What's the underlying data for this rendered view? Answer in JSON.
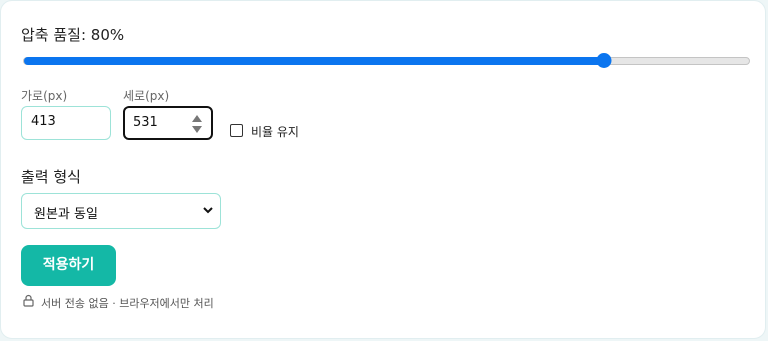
{
  "quality": {
    "label": "압축 품질: 80%",
    "value": 80,
    "min": 0,
    "max": 100,
    "accent_color": "#0b75ef"
  },
  "dimensions": {
    "width_label": "가로(px)",
    "width_value": "413",
    "height_label": "세로(px)",
    "height_value": "531",
    "keep_ratio_label": "비율 유지",
    "keep_ratio_checked": false
  },
  "format": {
    "label": "출력 형식",
    "selected": "원본과 동일",
    "chevron_icon": "chevron-down-icon"
  },
  "apply_button": {
    "label": "적용하기",
    "color": "#14b8a6"
  },
  "privacy_note": {
    "icon": "lock-icon",
    "text": "서버 전송 없음 · 브라우저에서만 처리"
  }
}
